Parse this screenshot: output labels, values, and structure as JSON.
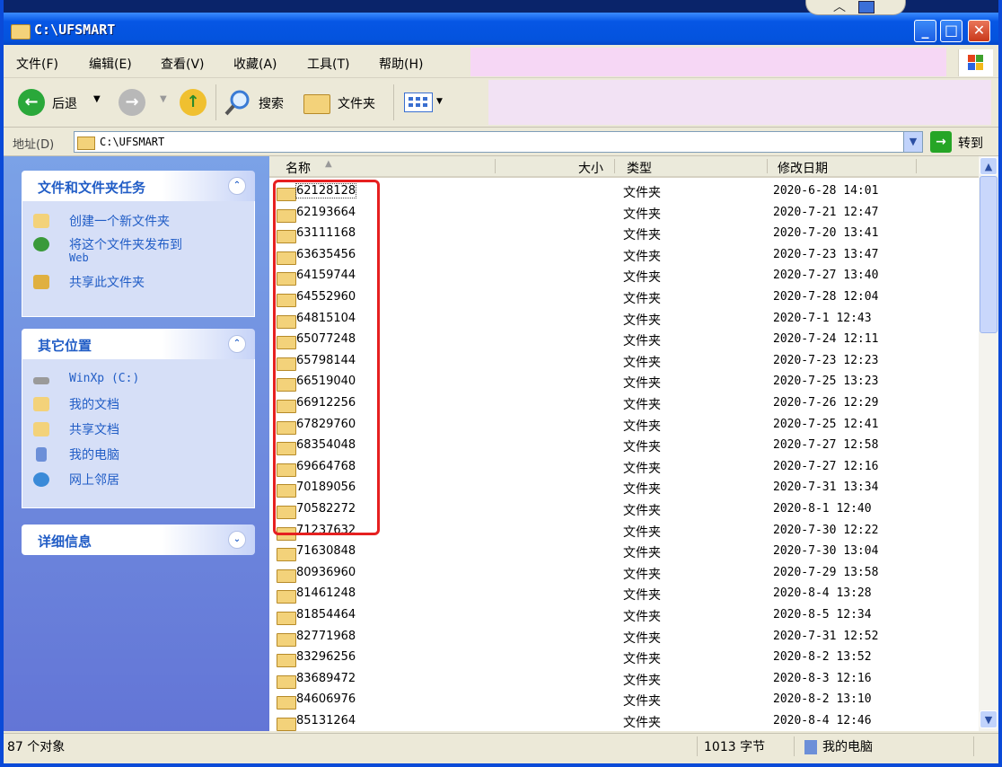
{
  "window": {
    "title": "C:\\UFSMART"
  },
  "menu": [
    "文件(F)",
    "编辑(E)",
    "查看(V)",
    "收藏(A)",
    "工具(T)",
    "帮助(H)"
  ],
  "toolbar": {
    "back_label": "后退",
    "search_label": "搜索",
    "folders_label": "文件夹"
  },
  "address": {
    "label": "地址(D)",
    "value": "C:\\UFSMART",
    "go_label": "转到"
  },
  "panels": {
    "tasks": {
      "title": "文件和文件夹任务",
      "items": [
        "创建一个新文件夹",
        "将这个文件夹发布到",
        "Web",
        "共享此文件夹"
      ]
    },
    "other": {
      "title": "其它位置",
      "items": [
        "WinXp (C:)",
        "我的文档",
        "共享文档",
        "我的电脑",
        "网上邻居"
      ]
    },
    "details": {
      "title": "详细信息"
    }
  },
  "columns": {
    "name": "名称",
    "size": "大小",
    "type": "类型",
    "date": "修改日期"
  },
  "files": [
    {
      "name": "62128128",
      "type": "文件夹",
      "date": "2020-6-28 14:01"
    },
    {
      "name": "62193664",
      "type": "文件夹",
      "date": "2020-7-21 12:47"
    },
    {
      "name": "63111168",
      "type": "文件夹",
      "date": "2020-7-20 13:41"
    },
    {
      "name": "63635456",
      "type": "文件夹",
      "date": "2020-7-23 13:47"
    },
    {
      "name": "64159744",
      "type": "文件夹",
      "date": "2020-7-27 13:40"
    },
    {
      "name": "64552960",
      "type": "文件夹",
      "date": "2020-7-28 12:04"
    },
    {
      "name": "64815104",
      "type": "文件夹",
      "date": "2020-7-1 12:43"
    },
    {
      "name": "65077248",
      "type": "文件夹",
      "date": "2020-7-24 12:11"
    },
    {
      "name": "65798144",
      "type": "文件夹",
      "date": "2020-7-23 12:23"
    },
    {
      "name": "66519040",
      "type": "文件夹",
      "date": "2020-7-25 13:23"
    },
    {
      "name": "66912256",
      "type": "文件夹",
      "date": "2020-7-26 12:29"
    },
    {
      "name": "67829760",
      "type": "文件夹",
      "date": "2020-7-25 12:41"
    },
    {
      "name": "68354048",
      "type": "文件夹",
      "date": "2020-7-27 12:58"
    },
    {
      "name": "69664768",
      "type": "文件夹",
      "date": "2020-7-27 12:16"
    },
    {
      "name": "70189056",
      "type": "文件夹",
      "date": "2020-7-31 13:34"
    },
    {
      "name": "70582272",
      "type": "文件夹",
      "date": "2020-8-1 12:40"
    },
    {
      "name": "71237632",
      "type": "文件夹",
      "date": "2020-7-30 12:22"
    },
    {
      "name": "71630848",
      "type": "文件夹",
      "date": "2020-7-30 13:04"
    },
    {
      "name": "80936960",
      "type": "文件夹",
      "date": "2020-7-29 13:58"
    },
    {
      "name": "81461248",
      "type": "文件夹",
      "date": "2020-8-4 13:28"
    },
    {
      "name": "81854464",
      "type": "文件夹",
      "date": "2020-8-5 12:34"
    },
    {
      "name": "82771968",
      "type": "文件夹",
      "date": "2020-7-31 12:52"
    },
    {
      "name": "83296256",
      "type": "文件夹",
      "date": "2020-8-2 13:52"
    },
    {
      "name": "83689472",
      "type": "文件夹",
      "date": "2020-8-3 12:16"
    },
    {
      "name": "84606976",
      "type": "文件夹",
      "date": "2020-8-2 13:10"
    },
    {
      "name": "85131264",
      "type": "文件夹",
      "date": "2020-8-4 12:46"
    }
  ],
  "status": {
    "count": "87 个对象",
    "size": "1013 字节",
    "location": "我的电脑"
  }
}
